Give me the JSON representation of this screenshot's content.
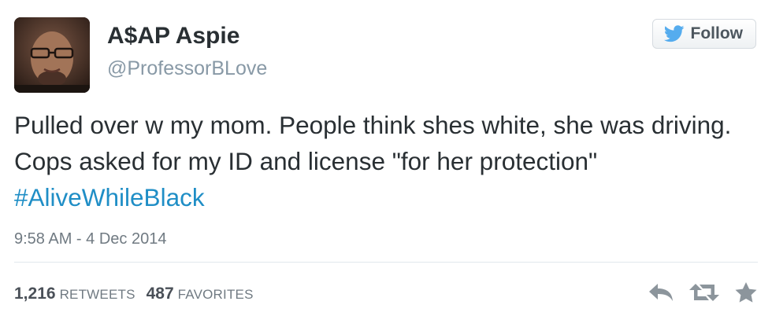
{
  "user": {
    "display_name": "A$AP Aspie",
    "handle": "@ProfessorBLove"
  },
  "follow_button": {
    "label": "Follow",
    "icon": "twitter-bird-icon"
  },
  "tweet": {
    "text": "Pulled over w my mom. People think shes white, she was driving. Cops asked for my ID and license \"for her protection\" ",
    "hashtag": "#AliveWhileBlack",
    "timestamp": "9:58 AM - 4 Dec 2014"
  },
  "stats": {
    "retweets_count": "1,216",
    "retweets_label": "RETWEETS",
    "favorites_count": "487",
    "favorites_label": "FAVORITES"
  },
  "actions": [
    "reply-icon",
    "retweet-icon",
    "favorite-star-icon"
  ],
  "colors": {
    "link": "#1f8ec6",
    "text": "#292f33",
    "muted": "#8899a6",
    "icon": "#8c959c"
  }
}
